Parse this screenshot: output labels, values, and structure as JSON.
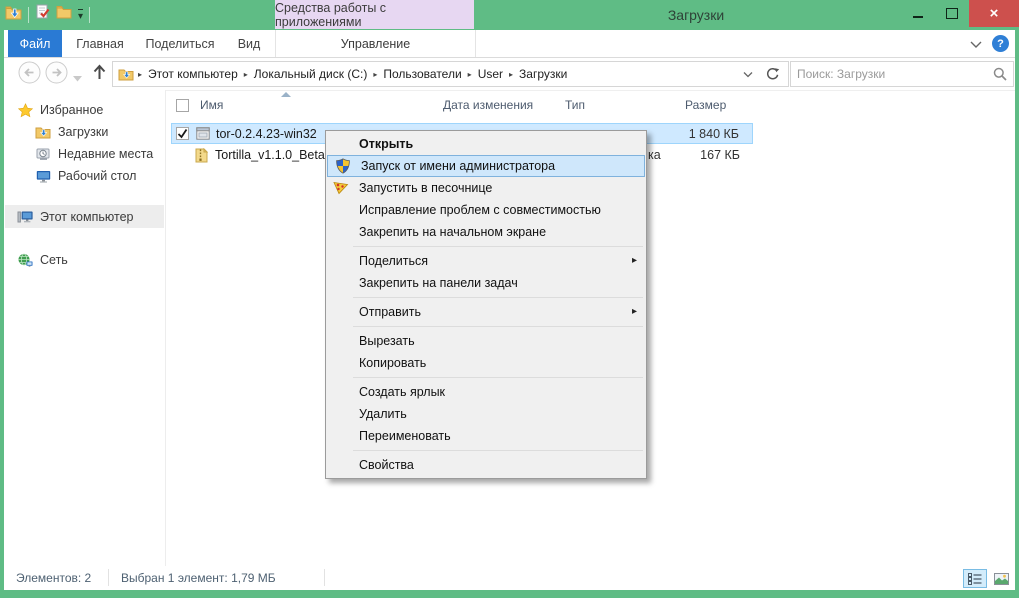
{
  "window": {
    "title": "Загрузки",
    "minimize_label": "",
    "maximize_label": "",
    "close_label": "×"
  },
  "titlebar": {
    "contextual_group": "Средства работы с приложениями"
  },
  "icons": {
    "qat": [
      "downloads-folder",
      "properties",
      "new-folder",
      "qat-dropdown"
    ],
    "nav": [
      "back-arrow",
      "forward-arrow",
      "history-dropdown",
      "up-arrow",
      "refresh",
      "search-magnifier",
      "help-question",
      "ribbon-collapse-chevron"
    ],
    "sidebar": [
      "star",
      "downloads-folder",
      "recent-places",
      "desktop-monitor",
      "this-pc",
      "network-globe"
    ],
    "files": [
      "application-exe",
      "zip-archive"
    ],
    "menu": [
      "uac-shield",
      "sandboxie"
    ],
    "statusbar": [
      "details-view",
      "thumbnail-view"
    ]
  },
  "ribbon": {
    "tabs": [
      {
        "label": "Файл"
      },
      {
        "label": "Главная"
      },
      {
        "label": "Поделиться"
      },
      {
        "label": "Вид"
      },
      {
        "label": "Управление"
      }
    ]
  },
  "navbar": {
    "breadcrumb": [
      "Этот компьютер",
      "Локальный диск (C:)",
      "Пользователи",
      "User",
      "Загрузки"
    ],
    "search_placeholder": "Поиск: Загрузки"
  },
  "sidebar": {
    "favorites_label": "Избранное",
    "favorites_items": [
      {
        "label": "Загрузки"
      },
      {
        "label": "Недавние места"
      },
      {
        "label": "Рабочий стол"
      }
    ],
    "this_pc_label": "Этот компьютер",
    "network_label": "Сеть"
  },
  "file_list": {
    "columns": [
      "Имя",
      "Дата изменения",
      "Тип",
      "Размер"
    ],
    "rows": [
      {
        "name": "tor-0.2.4.23-win32",
        "size": "1 840 КБ",
        "checked": true,
        "selected": true
      },
      {
        "name": "Tortilla_v1.1.0_Beta",
        "type_visible_fragment": "ка",
        "size": "167 КБ"
      }
    ]
  },
  "context_menu": {
    "items": [
      {
        "label": "Открыть"
      },
      {
        "label": "Запуск от имени администратора"
      },
      {
        "label": "Запустить в песочнице"
      },
      {
        "label": "Исправление проблем с совместимостью"
      },
      {
        "label": "Закрепить на начальном экране"
      },
      {
        "label": "Поделиться"
      },
      {
        "label": "Закрепить на панели задач"
      },
      {
        "label": "Отправить"
      },
      {
        "label": "Вырезать"
      },
      {
        "label": "Копировать"
      },
      {
        "label": "Создать ярлык"
      },
      {
        "label": "Удалить"
      },
      {
        "label": "Переименовать"
      },
      {
        "label": "Свойства"
      }
    ]
  },
  "status_bar": {
    "items_count": "Элементов: 2",
    "selection_info": "Выбран 1 элемент: 1,79 МБ"
  },
  "colors": {
    "titlebar_green": "#5fbc85",
    "close_red": "#cd504d",
    "file_tab_blue": "#2a7ad4",
    "contextual_lavender": "#e7d7f2",
    "selection_row_bg": "#cfe9ff",
    "selection_row_border": "#9ed5fc",
    "menu_highlight_bg": "#cfe7fb",
    "menu_highlight_border": "#7fb2dd"
  }
}
